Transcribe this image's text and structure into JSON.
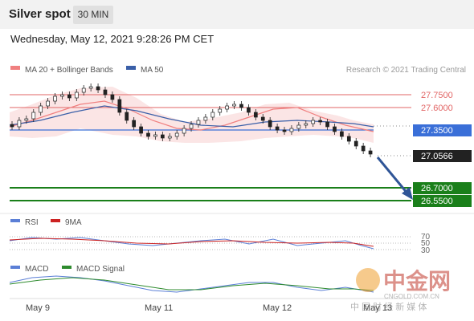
{
  "header": {
    "title": "Silver spot",
    "timeframe": "30 MIN"
  },
  "datetime": "Wednesday, May 12, 2021 9:28:26 PM CET",
  "legend": {
    "ma20": "MA 20 + Bollinger Bands",
    "ma50": "MA 50",
    "ma20_color": "#f08080",
    "ma50_color": "#3a5fa8",
    "credit": "Research © 2021 Trading Central"
  },
  "levels": {
    "r2": "27.7500",
    "r1": "27.6000",
    "pivot": "27.3500",
    "last": "27.0566",
    "s1": "26.7000",
    "s2": "26.5500"
  },
  "rsi_panel": {
    "label": "RSI",
    "ma_label": "9MA",
    "ticks": [
      "70",
      "50",
      "30"
    ]
  },
  "macd_panel": {
    "label": "MACD",
    "signal_label": "MACD Signal"
  },
  "xaxis": {
    "labels": [
      "May 9",
      "May 11",
      "May 12",
      "May 13"
    ]
  },
  "watermark": {
    "brand": "中金网",
    "url": "CNGOLD.COM.CN",
    "tagline": "中 国 财 经 新 媒 体"
  },
  "colors": {
    "resistance": "#e26666",
    "pivot": "#3a6fd8",
    "support": "#1a7f1a",
    "last": "#222222",
    "arrow": "#2f5597"
  }
}
